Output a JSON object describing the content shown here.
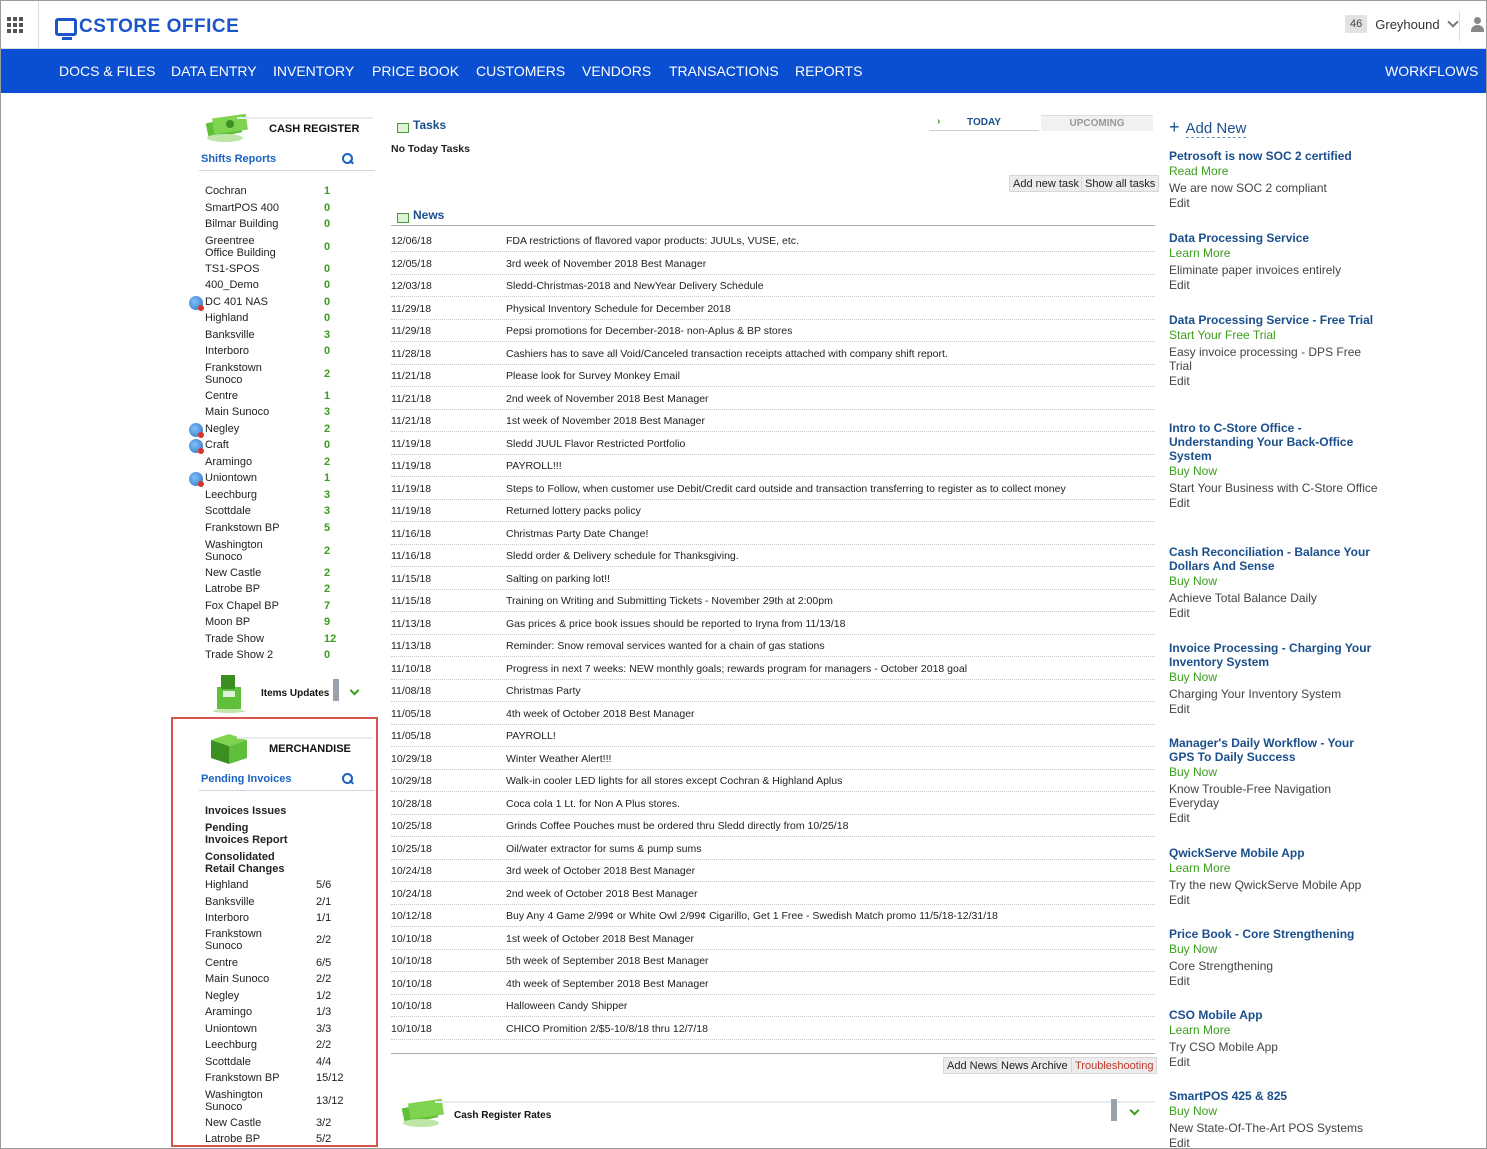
{
  "app": {
    "logo_text": "CSTORE OFFICE",
    "user_count": "46",
    "user_name": "Greyhound"
  },
  "nav": {
    "items": [
      "DOCS & FILES",
      "DATA ENTRY",
      "INVENTORY",
      "PRICE BOOK",
      "CUSTOMERS",
      "VENDORS",
      "TRANSACTIONS",
      "REPORTS"
    ],
    "right": "WORKFLOWS"
  },
  "cash_register": {
    "title": "CASH REGISTER",
    "sub_title": "Shifts Reports",
    "rows": [
      {
        "name": "Cochran",
        "value": "1"
      },
      {
        "name": "SmartPOS 400",
        "value": "0"
      },
      {
        "name": "Bilmar Building",
        "value": "0"
      },
      {
        "name": "Greentree Office Building",
        "value": "0"
      },
      {
        "name": "TS1-SPOS",
        "value": "0"
      },
      {
        "name": "400_Demo",
        "value": "0"
      },
      {
        "name": "DC 401 NAS",
        "value": "0"
      },
      {
        "name": "Highland",
        "value": "0"
      },
      {
        "name": "Banksville",
        "value": "3"
      },
      {
        "name": "Interboro",
        "value": "0"
      },
      {
        "name": "Frankstown Sunoco",
        "value": "2"
      },
      {
        "name": "Centre",
        "value": "1"
      },
      {
        "name": "Main Sunoco",
        "value": "3"
      },
      {
        "name": "Negley",
        "value": "2"
      },
      {
        "name": "Craft",
        "value": "0"
      },
      {
        "name": "Aramingo",
        "value": "2"
      },
      {
        "name": "Uniontown",
        "value": "1"
      },
      {
        "name": "Leechburg",
        "value": "3"
      },
      {
        "name": "Scottdale",
        "value": "3"
      },
      {
        "name": "Frankstown BP",
        "value": "5"
      },
      {
        "name": "Washington Sunoco",
        "value": "2"
      },
      {
        "name": "New Castle",
        "value": "2"
      },
      {
        "name": "Latrobe BP",
        "value": "2"
      },
      {
        "name": "Fox Chapel BP",
        "value": "7"
      },
      {
        "name": "Moon BP",
        "value": "9"
      },
      {
        "name": "Trade Show",
        "value": "12"
      },
      {
        "name": "Trade Show 2",
        "value": "0"
      }
    ],
    "items_updates": "Items Updates"
  },
  "merchandise": {
    "title": "MERCHANDISE",
    "sub_title": "Pending Invoices",
    "links": [
      "Invoices Issues",
      "Pending Invoices Report",
      "Consolidated Retail Changes"
    ],
    "rows": [
      {
        "name": "Highland",
        "value": "5/6"
      },
      {
        "name": "Banksville",
        "value": "2/1"
      },
      {
        "name": "Interboro",
        "value": "1/1"
      },
      {
        "name": "Frankstown Sunoco",
        "value": "2/2"
      },
      {
        "name": "Centre",
        "value": "6/5"
      },
      {
        "name": "Main Sunoco",
        "value": "2/2"
      },
      {
        "name": "Negley",
        "value": "1/2"
      },
      {
        "name": "Aramingo",
        "value": "1/3"
      },
      {
        "name": "Uniontown",
        "value": "3/3"
      },
      {
        "name": "Leechburg",
        "value": "2/2"
      },
      {
        "name": "Scottdale",
        "value": "4/4"
      },
      {
        "name": "Frankstown BP",
        "value": "15/12"
      },
      {
        "name": "Washington Sunoco",
        "value": "13/12"
      },
      {
        "name": "New Castle",
        "value": "3/2"
      },
      {
        "name": "Latrobe BP",
        "value": "5/2"
      }
    ]
  },
  "tasks": {
    "title": "Tasks",
    "tab_today": "TODAY",
    "tab_upcoming": "UPCOMING",
    "empty": "No Today Tasks",
    "add_task": "Add new task",
    "show_all": "Show all tasks"
  },
  "news": {
    "title": "News",
    "items": [
      {
        "date": "12/06/18",
        "text": "FDA restrictions of flavored vapor products: JUULs, VUSE, etc."
      },
      {
        "date": "12/05/18",
        "text": "3rd week of November 2018 Best Manager"
      },
      {
        "date": "12/03/18",
        "text": "Sledd-Christmas-2018 and NewYear Delivery Schedule"
      },
      {
        "date": "11/29/18",
        "text": "Physical Inventory Schedule for December 2018"
      },
      {
        "date": "11/29/18",
        "text": "Pepsi promotions for December-2018- non-Aplus & BP stores"
      },
      {
        "date": "11/28/18",
        "text": "Cashiers has to save all Void/Canceled transaction receipts attached with company shift report."
      },
      {
        "date": "11/21/18",
        "text": "Please look for Survey Monkey Email"
      },
      {
        "date": "11/21/18",
        "text": "2nd week of November 2018 Best Manager"
      },
      {
        "date": "11/21/18",
        "text": "1st week of November 2018 Best Manager"
      },
      {
        "date": "11/19/18",
        "text": "Sledd JUUL Flavor Restricted Portfolio"
      },
      {
        "date": "11/19/18",
        "text": "PAYROLL!!!"
      },
      {
        "date": "11/19/18",
        "text": "Steps to Follow, when customer use Debit/Credit card outside and transaction transferring to register as to collect money"
      },
      {
        "date": "11/19/18",
        "text": "Returned lottery packs policy"
      },
      {
        "date": "11/16/18",
        "text": "Christmas Party Date Change!"
      },
      {
        "date": "11/16/18",
        "text": "Sledd order & Delivery schedule for Thanksgiving."
      },
      {
        "date": "11/15/18",
        "text": "Salting on parking lot!!"
      },
      {
        "date": "11/15/18",
        "text": "Training on Writing and Submitting Tickets - November 29th at 2:00pm"
      },
      {
        "date": "11/13/18",
        "text": "Gas prices & price book issues should be reported to Iryna from 11/13/18"
      },
      {
        "date": "11/13/18",
        "text": "Reminder: Snow removal services wanted for a chain of gas stations"
      },
      {
        "date": "11/10/18",
        "text": "Progress in next 7 weeks: NEW monthly goals; rewards program for managers - October 2018 goal"
      },
      {
        "date": "11/08/18",
        "text": "Christmas Party"
      },
      {
        "date": "11/05/18",
        "text": "4th week of October 2018 Best Manager"
      },
      {
        "date": "11/05/18",
        "text": "PAYROLL!"
      },
      {
        "date": "10/29/18",
        "text": "Winter Weather Alert!!!"
      },
      {
        "date": "10/29/18",
        "text": "Walk-in cooler LED lights for all stores except Cochran & Highland Aplus"
      },
      {
        "date": "10/28/18",
        "text": "Coca cola 1 Lt. for Non A Plus stores."
      },
      {
        "date": "10/25/18",
        "text": "Grinds Coffee Pouches must be ordered thru Sledd directly from 10/25/18"
      },
      {
        "date": "10/25/18",
        "text": "Oil/water extractor for sums & pump sums"
      },
      {
        "date": "10/24/18",
        "text": "3rd week of October 2018 Best Manager"
      },
      {
        "date": "10/24/18",
        "text": "2nd week of October 2018 Best Manager"
      },
      {
        "date": "10/12/18",
        "text": "Buy Any 4 Game 2/99¢ or White Owl 2/99¢ Cigarillo, Get 1 Free - Swedish Match promo 11/5/18-12/31/18"
      },
      {
        "date": "10/10/18",
        "text": "1st week of October 2018 Best Manager"
      },
      {
        "date": "10/10/18",
        "text": "5th week of September 2018 Best Manager"
      },
      {
        "date": "10/10/18",
        "text": "4th week of September 2018 Best Manager"
      },
      {
        "date": "10/10/18",
        "text": "Halloween Candy Shipper"
      },
      {
        "date": "10/10/18",
        "text": "CHICO Promition 2/$5-10/8/18 thru 12/7/18"
      }
    ],
    "add_news": "Add News",
    "archive": "News Archive",
    "troubleshooting": "Troubleshooting"
  },
  "cash_register_rates": {
    "title": "Cash Register Rates"
  },
  "sidebar_right": {
    "add_new": "Add New",
    "ads": [
      {
        "title": "Petrosoft is now SOC 2 certified",
        "link": "Read More",
        "desc": "We are now SOC 2 compliant",
        "edit": "Edit"
      },
      {
        "title": "Data Processing Service",
        "link": "Learn More",
        "desc": "Eliminate paper invoices entirely",
        "edit": "Edit"
      },
      {
        "title": "Data Processing Service - Free Trial",
        "link": "Start Your Free Trial",
        "desc": "Easy invoice processing - DPS Free Trial",
        "edit": "Edit"
      },
      {
        "title": "Intro to C-Store Office - Understanding Your Back-Office System",
        "link": "Buy Now",
        "desc": "Start Your Business with C-Store Office",
        "edit": "Edit"
      },
      {
        "title": "Cash Reconciliation - Balance Your Dollars And Sense",
        "link": "Buy Now",
        "desc": "Achieve Total Balance Daily",
        "edit": "Edit"
      },
      {
        "title": "Invoice Processing - Charging Your Inventory System",
        "link": "Buy Now",
        "desc": "Charging Your Inventory System",
        "edit": "Edit"
      },
      {
        "title": "Manager's Daily Workflow - Your GPS To Daily Success",
        "link": "Buy Now",
        "desc": "Know Trouble-Free Navigation Everyday",
        "edit": "Edit"
      },
      {
        "title": "QwickServe Mobile App",
        "link": "Learn More",
        "desc": "Try the new QwickServe Mobile App",
        "edit": "Edit"
      },
      {
        "title": "Price Book - Core Strengthening",
        "link": "Buy Now",
        "desc": "Core Strengthening",
        "edit": "Edit"
      },
      {
        "title": "CSO Mobile App",
        "link": "Learn More",
        "desc": "Try CSO Mobile App",
        "edit": "Edit"
      },
      {
        "title": "SmartPOS 425 & 825",
        "link": "Buy Now",
        "desc": "New State-Of-The-Art POS Systems",
        "edit": "Edit"
      }
    ]
  }
}
